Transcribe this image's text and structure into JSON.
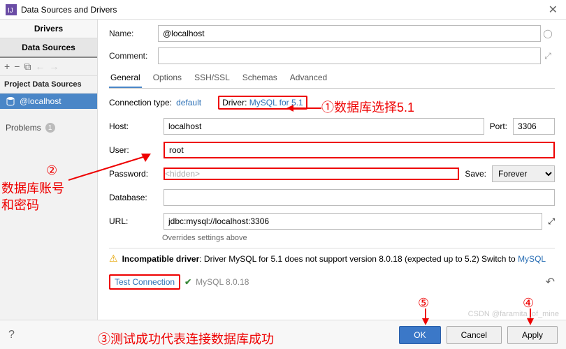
{
  "window": {
    "title": "Data Sources and Drivers"
  },
  "sidebar": {
    "tabs": [
      "Drivers",
      "Data Sources"
    ],
    "section": "Project Data Sources",
    "item": "@localhost",
    "problems": {
      "label": "Problems",
      "count": "1"
    }
  },
  "form": {
    "name_label": "Name:",
    "name": "@localhost",
    "comment_label": "Comment:",
    "tabs": [
      "General",
      "Options",
      "SSH/SSL",
      "Schemas",
      "Advanced"
    ],
    "conn_type_label": "Connection type:",
    "conn_type": "default",
    "driver_label": "Driver:",
    "driver": "MySQL for 5.1",
    "host_label": "Host:",
    "host": "localhost",
    "port_label": "Port:",
    "port": "3306",
    "user_label": "User:",
    "user": "root",
    "password_label": "Password:",
    "password_ph": "<hidden>",
    "save_label": "Save:",
    "save": "Forever",
    "database_label": "Database:",
    "url_label": "URL:",
    "url": "jdbc:mysql://localhost:3306",
    "override": "Overrides settings above"
  },
  "warning": {
    "strong": "Incompatible driver",
    "text": ": Driver MySQL for 5.1 does not support version 8.0.18 (expected up to 5.2) Switch to",
    "link": "MySQL"
  },
  "test": {
    "label": "Test Connection",
    "version": "MySQL 8.0.18"
  },
  "footer": {
    "ok": "OK",
    "cancel": "Cancel",
    "apply": "Apply"
  },
  "annot": {
    "a1": "①数据库选择5.1",
    "a2_num": "②",
    "a2a": "数据库账号",
    "a2b": "和密码",
    "a3": "③测试成功代表连接数据库成功",
    "a4": "④",
    "a5": "⑤"
  },
  "watermark": "CSDN @faramita_of_mine"
}
